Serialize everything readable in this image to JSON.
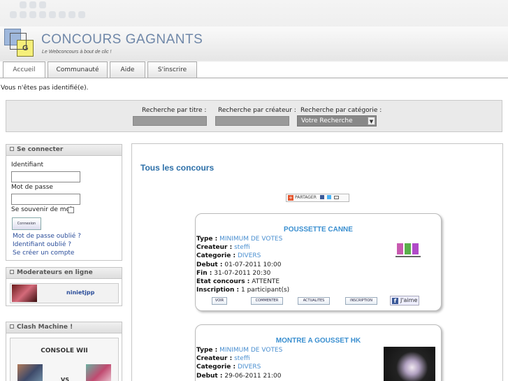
{
  "header": {
    "title": "CONCOURS GAGNANTS",
    "subtitle": "Le Webconcours à bout de clic !",
    "logo_letter": "G"
  },
  "nav": {
    "tabs": [
      {
        "label": "Accueil",
        "active": true
      },
      {
        "label": "Communauté",
        "active": false
      },
      {
        "label": "Aide",
        "active": false
      },
      {
        "label": "S'inscrire",
        "active": false
      }
    ]
  },
  "notice": "Vous n'êtes pas identifié(e).",
  "search": {
    "by_title_label": "Recherche par titre :",
    "by_creator_label": "Recherche par créateur :",
    "by_category_label": "Recherche par catégorie :",
    "category_selected": "Votre Recherche"
  },
  "login": {
    "heading": "Se connecter",
    "username_label": "Identifiant",
    "password_label": "Mot de passe",
    "remember_label": "Se souvenir de moi",
    "submit_label": "Connexion",
    "forgot_password": "Mot de passe oublié ?",
    "forgot_username": "Identifiant oublié ?",
    "create_account": "Se créer un compte"
  },
  "moderators": {
    "heading": "Moderateurs en ligne",
    "items": [
      {
        "name": "ninietjpp"
      }
    ]
  },
  "clash": {
    "heading": "Clash Machine !",
    "title": "CONSOLE WII",
    "vs": "VS"
  },
  "main": {
    "title": "Tous les concours",
    "share_label": "PARTAGER"
  },
  "contests": [
    {
      "title": "POUSSETTE CANNE",
      "type_label": "Type :",
      "type": "MINIMUM DE VOTES",
      "creator_label": "Createur :",
      "creator": "steffi",
      "category_label": "Categorie :",
      "category": "DIVERS",
      "start_label": "Debut :",
      "start": "01-07-2011 10:00",
      "end_label": "Fin :",
      "end": "31-07-2011 20:30",
      "state_label": "Etat concours :",
      "state": "ATTENTE",
      "signup_label": "Inscription :",
      "signup": "1 participant(s)",
      "actions": {
        "view": "VOIR",
        "comment": "COMMENTER",
        "news": "ACTUALITES",
        "register": "INSCRIPTION",
        "like": "J'aime"
      }
    },
    {
      "title": "MONTRE A GOUSSET HK",
      "type_label": "Type :",
      "type": "MINIMUM DE VOTES",
      "creator_label": "Createur :",
      "creator": "steffi",
      "category_label": "Categorie :",
      "category": "DIVERS",
      "start_label": "Debut :",
      "start": "29-06-2011 21:00"
    }
  ],
  "colors": {
    "accent": "#2c6fa8",
    "link": "#4a8fd0",
    "brand_blue": "#6f87a8"
  }
}
